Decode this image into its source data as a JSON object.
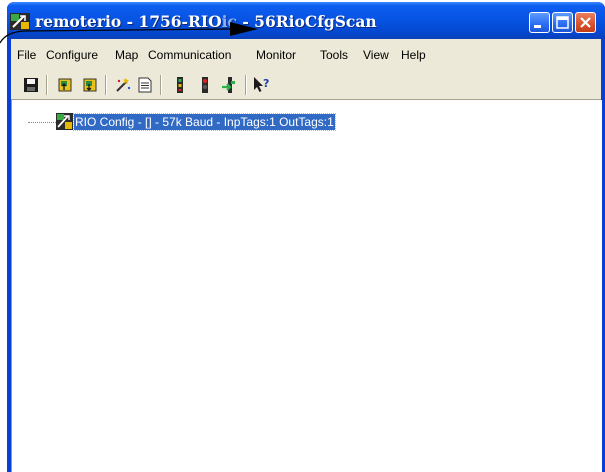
{
  "window": {
    "title": "remoterio - 1756-RIO",
    "title_partial": "ic",
    "title_suffix": " - 56RioCfgScan"
  },
  "menu": [
    "File",
    "Configure",
    "Map",
    "Communication",
    "Monitor",
    "Tools",
    "View",
    "Help"
  ],
  "toolbar": {
    "icons": [
      "save-icon",
      "upload-icon",
      "download-icon",
      "wizard-icon",
      "report-icon",
      "io-module-icon",
      "stop-icon",
      "connect-icon",
      "help-pointer-icon"
    ]
  },
  "tree": {
    "nodes": [
      {
        "label": "RIO Config - [] -  57k Baud - InpTags:1 OutTags:1",
        "icon": "rio-config-icon"
      }
    ]
  },
  "colors": {
    "titlebar": "#0651e0",
    "selection": "#316ac5",
    "chrome": "#ece9d8"
  }
}
